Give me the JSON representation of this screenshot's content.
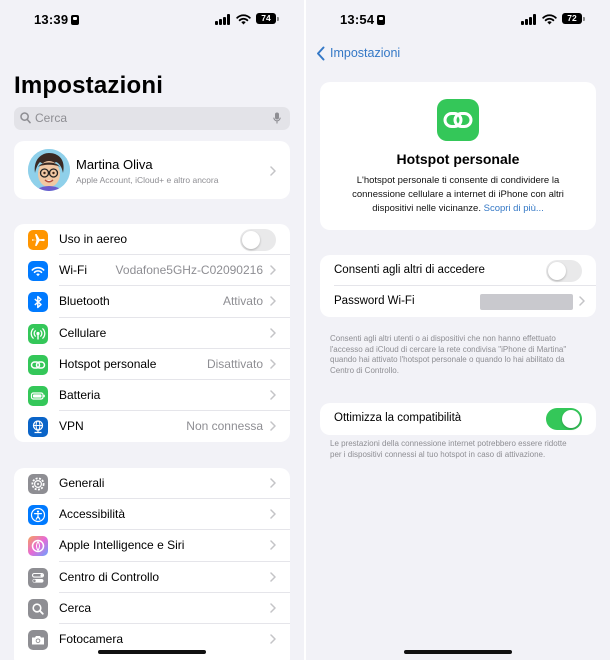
{
  "left": {
    "status": {
      "time": "13:39",
      "battery": "74"
    },
    "title": "Impostazioni",
    "search_placeholder": "Cerca",
    "profile": {
      "name": "Martina Oliva",
      "subtitle": "Apple Account, iCloud+ e altro ancora"
    },
    "connectivity": [
      {
        "label": "Uso in aereo",
        "value": "",
        "icon": "airplane-icon",
        "color": "#ff9500",
        "toggle": "off"
      },
      {
        "label": "Wi-Fi",
        "value": "Vodafone5GHz-C02090216",
        "icon": "wifi-icon",
        "color": "#007aff"
      },
      {
        "label": "Bluetooth",
        "value": "Attivato",
        "icon": "bluetooth-icon",
        "color": "#007aff"
      },
      {
        "label": "Cellulare",
        "value": "",
        "icon": "cellular-icon",
        "color": "#34c759"
      },
      {
        "label": "Hotspot personale",
        "value": "Disattivato",
        "icon": "hotspot-icon",
        "color": "#34c759"
      },
      {
        "label": "Batteria",
        "value": "",
        "icon": "battery-icon",
        "color": "#34c759"
      },
      {
        "label": "VPN",
        "value": "Non connessa",
        "icon": "vpn-icon",
        "color": "#0a64c8"
      }
    ],
    "general": [
      {
        "label": "Generali",
        "icon": "gear-icon",
        "color": "#8e8e93"
      },
      {
        "label": "Accessibilità",
        "icon": "accessibility-icon",
        "color": "#007aff"
      },
      {
        "label": "Apple Intelligence e Siri",
        "icon": "siri-icon",
        "color": "#c86cf0"
      },
      {
        "label": "Centro di Controllo",
        "icon": "control-center-icon",
        "color": "#8e8e93"
      },
      {
        "label": "Cerca",
        "icon": "search-icon",
        "color": "#8e8e93"
      },
      {
        "label": "Fotocamera",
        "icon": "camera-icon",
        "color": "#8e8e93"
      }
    ]
  },
  "right": {
    "status": {
      "time": "13:54",
      "battery": "72"
    },
    "back_label": "Impostazioni",
    "hotspot": {
      "title": "Hotspot personale",
      "description": "L'hotspot personale ti consente di condividere la connessione cellulare a internet di iPhone con altri dispositivi nelle vicinanze.",
      "link": "Scopri di più..."
    },
    "allow_others": {
      "label": "Consenti agli altri di accedere",
      "toggle": "off"
    },
    "password": {
      "label": "Password Wi-Fi"
    },
    "footnote1": "Consenti agli altri utenti o ai dispositivi che non hanno effettuato l'accesso ad iCloud di cercare la rete condivisa \"iPhone di Martina\" quando hai attivato l'hotspot personale o quando lo hai abilitato da Centro di Controllo.",
    "compatibility": {
      "label": "Ottimizza la compatibilità",
      "toggle": "on"
    },
    "footnote2": "Le prestazioni della connessione internet potrebbero essere ridotte per i dispositivi connessi al tuo hotspot in caso di attivazione."
  }
}
